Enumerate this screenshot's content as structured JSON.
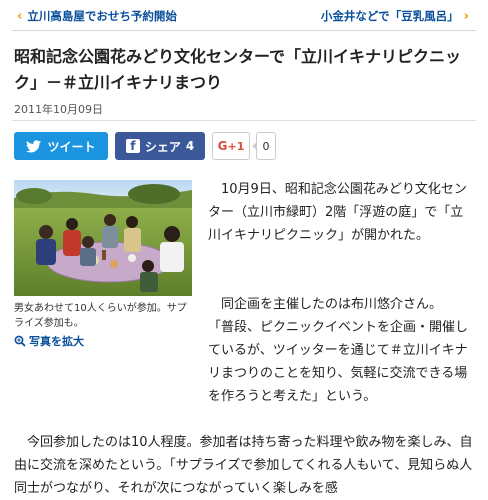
{
  "nav": {
    "prev_label": "立川高島屋でおせち予約開始",
    "next_label": "小金井などで「豆乳風呂」"
  },
  "article": {
    "title": "昭和記念公園花みどり文化センターで「立川イキナリピクニック」－＃立川イキナリまつり",
    "date": "2011年10月09日"
  },
  "social": {
    "tweet_label": "ツイート",
    "share_label": "シェア",
    "share_count": "4",
    "gplus_label": "+1",
    "gplus_count": "0"
  },
  "photo": {
    "caption": "男女あわせて10人くらいが参加。サプライズ参加も。",
    "zoom_label": "写真を拡大"
  },
  "body": {
    "p1": "10月9日、昭和記念公園花みどり文化センター（立川市緑町）2階「浮遊の庭」で「立川イキナリピクニック」が開かれた。",
    "p2_head": "同企画を主催したのは布川悠介さん。",
    "p2_rest": "「普段、ピクニックイベントを企画・開催しているが、ツイッターを通じて＃立川イキナリまつりのことを知り、気軽に交流できる場を作ろうと考えた」という。",
    "p3": "今回参加したのは10人程度。参加者は持ち寄った料理や飲み物を楽しみ、自由に交流を深めたという。「サプライズで参加してくれる人もいて、見知らぬ人同士がつながり、それが次につながっていく楽しみを感"
  },
  "colors": {
    "link": "#0a4f9c",
    "chevron": "#e8a100",
    "twitter": "#1b95e0",
    "facebook": "#3b5998",
    "gplus": "#dd4b39"
  }
}
